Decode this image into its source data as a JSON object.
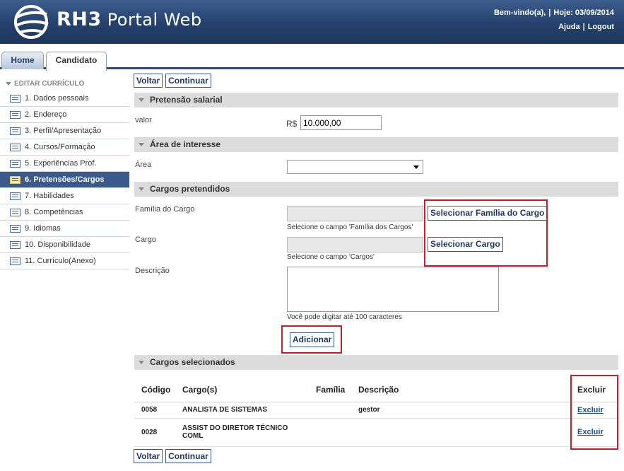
{
  "header": {
    "logo_brand": "RH3",
    "logo_product": "Portal Web",
    "welcome": "Bem-vindo(a),",
    "sep": "|",
    "today": "Hoje: 03/09/2014",
    "help": "Ajuda",
    "logout": "Logout"
  },
  "tabs": [
    {
      "label": "Home"
    },
    {
      "label": "Candidato"
    }
  ],
  "sidebar": {
    "heading": "EDITAR CURRÍCULO",
    "items": [
      {
        "label": "1. Dados pessoais"
      },
      {
        "label": "2. Endereço"
      },
      {
        "label": "3. Perfil/Apresentação"
      },
      {
        "label": "4. Cursos/Formação"
      },
      {
        "label": "5. Experiências Prof."
      },
      {
        "label": "6. Pretensões/Cargos"
      },
      {
        "label": "7. Habilidades"
      },
      {
        "label": "8. Competências"
      },
      {
        "label": "9. Idiomas"
      },
      {
        "label": "10. Disponibilidade"
      },
      {
        "label": "11. Currículo(Anexo)"
      }
    ],
    "active_index": 5
  },
  "toolbar": {
    "back": "Voltar",
    "next": "Continuar"
  },
  "salary": {
    "title": "Pretensão salarial",
    "label": "valor",
    "currency": "R$",
    "value": "10.000,00"
  },
  "area": {
    "title": "Área de interesse",
    "label": "Área",
    "selected": ""
  },
  "positions": {
    "title": "Cargos pretendidos",
    "family_label": "Família do Cargo",
    "family_hint": "Selecione o campo 'Família dos Cargos'",
    "family_button": "Selecionar Família do Cargo",
    "cargo_label": "Cargo",
    "cargo_hint": "Selecione o campo 'Cargos'",
    "cargo_button": "Selecionar Cargo",
    "desc_label": "Descrição",
    "desc_hint": "Você pode digitar até 100 caracteres",
    "add_button": "Adicionar"
  },
  "selected": {
    "title": "Cargos selecionados",
    "columns": [
      "Código",
      "Cargo(s)",
      "Família",
      "Descrição",
      "Excluir"
    ],
    "rows": [
      {
        "code": "0058",
        "cargo": "ANALISTA DE SISTEMAS",
        "family": "",
        "desc": "gestor",
        "action": "Excluir"
      },
      {
        "code": "0028",
        "cargo": "ASSIST DO DIRETOR TÉCNICO COML",
        "family": "",
        "desc": "",
        "action": "Excluir"
      }
    ]
  },
  "colors": {
    "header": "#24416c",
    "accent": "#3a5a8c",
    "highlight": "#d11a2a"
  }
}
